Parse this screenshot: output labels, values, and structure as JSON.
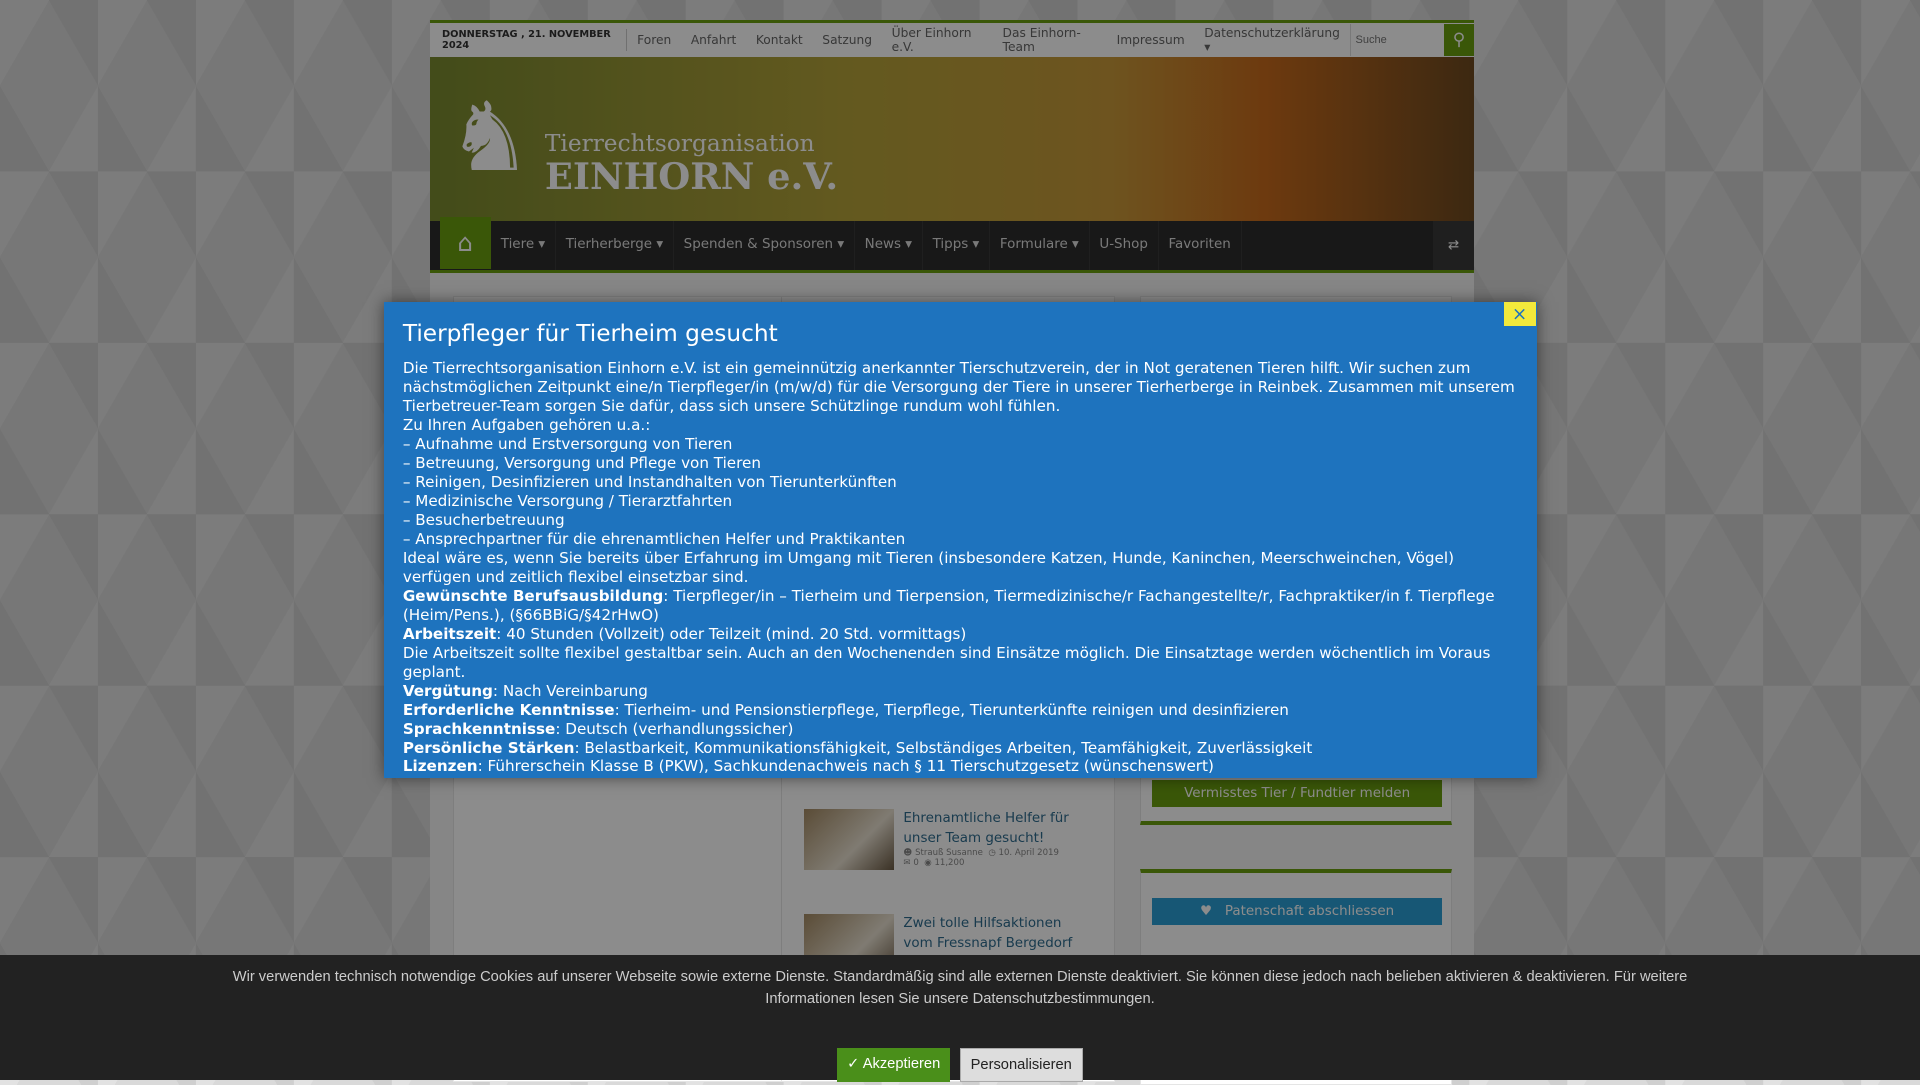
{
  "topbar": {
    "date": "DONNERSTAG , 21. NOVEMBER 2024",
    "links": [
      "Foren",
      "Anfahrt",
      "Kontakt",
      "Satzung",
      "Über Einhorn e.V.",
      "Das Einhorn-Team",
      "Impressum",
      "Datenschutzerklärung ▾"
    ],
    "search_placeholder": "Suche"
  },
  "header": {
    "logo_line1": "Tierrechtsorganisation",
    "logo_line2": "EINHORN e.V."
  },
  "nav": {
    "items": [
      "Tiere ▾",
      "Tierherberge ▾",
      "Spenden & Sponsoren ▾",
      "News ▾",
      "Tipps ▾",
      "Formulare ▾",
      "U-Shop",
      "Favoriten"
    ]
  },
  "posts": [
    {
      "title": "Ehrenamtliche Helfer für unser Team gesucht!",
      "author": "Strauß Susanne",
      "date": "10. April 2019",
      "comments": "0",
      "views": "11,200"
    },
    {
      "title": "Zwei tolle Hilfsaktionen vom Fressnapf Bergedorf"
    }
  ],
  "sidebar": {
    "lost_button": "Vermisstes Tier / Fundtier melden",
    "sponsor_button": "Patenschaft abschliessen"
  },
  "modal": {
    "title": "Tierpfleger für Tierheim gesucht",
    "intro": "Die Tierrechtsorganisation Einhorn e.V. ist ein gemeinnützig anerkannter Tierschutzverein,  der in Not geratenen Tieren hilft. Wir suchen zum nächstmöglichen Zeitpunkt eine/n Tierpfleger/in (m/w/d) für die Versorgung der Tiere in unserer Tierherberge in Reinbek. Zusammen mit unserem Tierbetreuer-Team sorgen Sie dafür, dass sich unsere Schützlinge rundum wohl fühlen.",
    "tasks_heading": "Zu Ihren Aufgaben gehören u.a.:",
    "tasks": [
      "– Aufnahme und Erstversorgung von Tieren",
      "– Betreuung, Versorgung und Pflege von Tieren",
      "– Reinigen, Desinfizieren und Instandhalten von Tierunterkünften",
      "– Medizinische Versorgung / Tierarztfahrten",
      "– Besucherbetreuung",
      "– Ansprechpartner für die ehrenamtlichen Helfer und Praktikanten"
    ],
    "ideal": "Ideal wäre es, wenn Sie bereits über Erfahrung im Umgang mit Tieren (insbesondere Katzen, Hunde, Kaninchen, Meerschweinchen, Vögel) verfügen und zeitlich flexibel einsetzbar sind.",
    "fields": [
      {
        "label": "Gewünschte Berufsausbildung",
        "value": ": Tierpfleger/in – Tierheim und Tierpension, Tiermedizinische/r Fachangestellte/r, Fachpraktiker/in f. Tierpflege (Heim/Pens.), (§66BBiG/§42rHwO)"
      },
      {
        "label": "Arbeitszeit",
        "value": ": 40 Stunden (Vollzeit) oder Teilzeit (mind. 20 Std. vormittags)"
      }
    ],
    "worktime_note": "Die Arbeitszeit sollte flexibel gestaltbar sein. Auch an den Wochenenden sind Einsätze möglich. Die Einsatztage werden wöchentlich im Voraus geplant.",
    "fields2": [
      {
        "label": "Vergütung",
        "value": ": Nach Vereinbarung"
      },
      {
        "label": "Erforderliche Kenntnisse",
        "value": ": Tierheim- und Pensionstierpflege, Tierpflege, Tierunterkünfte reinigen und desinfizieren"
      },
      {
        "label": "Sprachkenntnisse",
        "value": ": Deutsch (verhandlungssicher)"
      },
      {
        "label": "Persönliche Stärken",
        "value": ": Belastbarkeit, Kommunikationsfähigkeit, Selbständiges Arbeiten, Teamfähigkeit, Zuverlässigkeit"
      },
      {
        "label": "Lizenzen",
        "value": ": Führerschein Klasse B (PKW), Sachkundenachweis nach § 11 Tierschutzgesetz (wünschenswert)"
      }
    ],
    "close_icon": "×"
  },
  "cookie": {
    "text": "Wir verwenden technisch notwendige Cookies auf unserer Webseite sowie externe Dienste. Standardmäßig sind alle externen Dienste deaktiviert. Sie können diese jedoch nach belieben aktivieren & deaktivieren. Für weitere Informationen lesen Sie unsere Datenschutzbestimmungen.",
    "accept": "✓ Akzeptieren",
    "personalize": "Personalisieren"
  },
  "colors": {
    "accent": "#6a9e0f",
    "modal": "#1e73be",
    "close": "#f3e93b"
  }
}
